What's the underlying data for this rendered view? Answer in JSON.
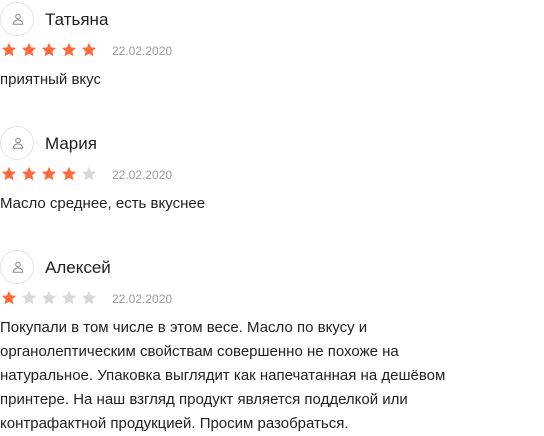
{
  "colors": {
    "star_filled": "#FF6A3D",
    "star_empty": "#D9D9D9",
    "date": "#9B9B9B",
    "avatar_border": "#E4E4E4"
  },
  "reviews": [
    {
      "author": "Татьяна",
      "rating": 5,
      "max_rating": 5,
      "date": "22.02.2020",
      "text": "приятный вкус",
      "avatar_icon": "user-icon"
    },
    {
      "author": "Мария",
      "rating": 4,
      "max_rating": 5,
      "date": "22.02.2020",
      "text": "Масло среднее, есть вкуснее",
      "avatar_icon": "user-icon"
    },
    {
      "author": "Алексей",
      "rating": 1,
      "max_rating": 5,
      "date": "22.02.2020",
      "text": "Покупали в том числе в этом весе. Масло по вкусу и органолептическим свойствам совершенно не похоже на натуральное. Упаковка выглядит как напечатанная на дешёвом принтере. На наш взгляд продукт является подделкой или контрафактной продукцией. Просим разобраться.",
      "avatar_icon": "user-icon"
    }
  ]
}
